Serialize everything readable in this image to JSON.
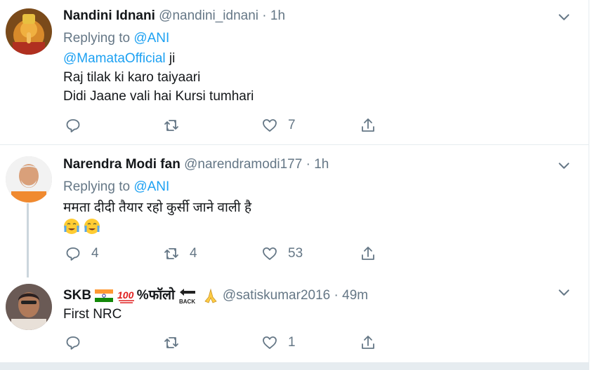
{
  "tweets": [
    {
      "name": "Nandini Idnani",
      "handle": "@nandini_idnani",
      "time": "1h",
      "replying_label": "Replying to",
      "replying_to": "@ANI",
      "mention": "@MamataOfficial",
      "mention_suffix": " ji",
      "lines": [
        "Raj tilak ki karo taiyaari",
        "Didi Jaane vali hai Kursi tumhari"
      ],
      "reply_count": "",
      "retweet_count": "",
      "like_count": "7"
    },
    {
      "name": "Narendra Modi fan",
      "handle": "@narendramodi177",
      "time": "1h",
      "replying_label": "Replying to",
      "replying_to": "@ANI",
      "lines": [
        "ममता दीदी तैयार रहो कुर्सी जाने वाली है"
      ],
      "reply_count": "4",
      "retweet_count": "4",
      "like_count": "53"
    },
    {
      "name": "SKB",
      "name_suffix": "%फॉलो",
      "handle": "@satiskumar2016",
      "time": "49m",
      "lines": [
        "First NRC"
      ],
      "reply_count": "",
      "retweet_count": "",
      "like_count": "1"
    }
  ],
  "dot": "·",
  "icons": [
    "reply-icon",
    "retweet-icon",
    "like-icon",
    "share-icon",
    "chevron-down-icon",
    "crying-emoji-icon",
    "india-flag-icon",
    "hundred-icon",
    "back-arrow-icon",
    "folded-hands-icon"
  ],
  "colors": {
    "link": "#1da1f2",
    "muted": "#657786",
    "text": "#14171a",
    "border": "#e6ecf0"
  }
}
